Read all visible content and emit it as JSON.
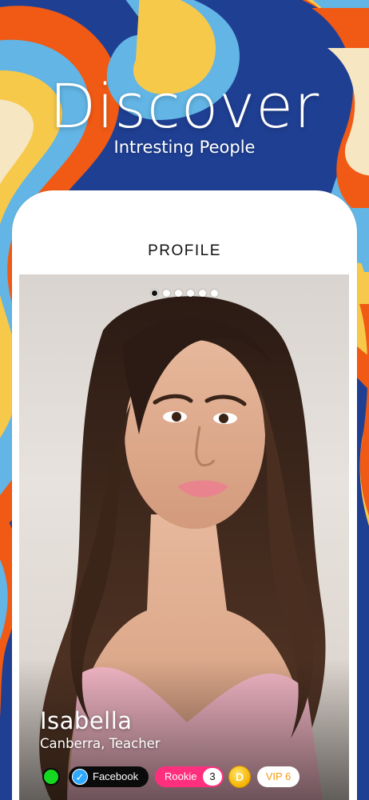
{
  "hero": {
    "title": "Discover",
    "subtitle": "Intresting People"
  },
  "screen": {
    "title": "PROFILE"
  },
  "carousel": {
    "count": 6,
    "active_index": 0
  },
  "profile": {
    "name": "Isabella",
    "location_job": "Canberra, Teacher",
    "online_status_color": "#17d820",
    "facebook_label": "Facebook",
    "level_label": "Rookie",
    "level_number": "3",
    "coin_symbol": "D",
    "vip_label": "VIP 6"
  },
  "colors": {
    "background_blue": "#1f3f93",
    "swirl_orange": "#f05a14",
    "swirl_yellow": "#f6c94b",
    "swirl_lightblue": "#62b5e5",
    "swirl_cream": "#f6e6c1",
    "rookie_pink": "#ff2f7d",
    "vip_orange": "#f29a12"
  }
}
